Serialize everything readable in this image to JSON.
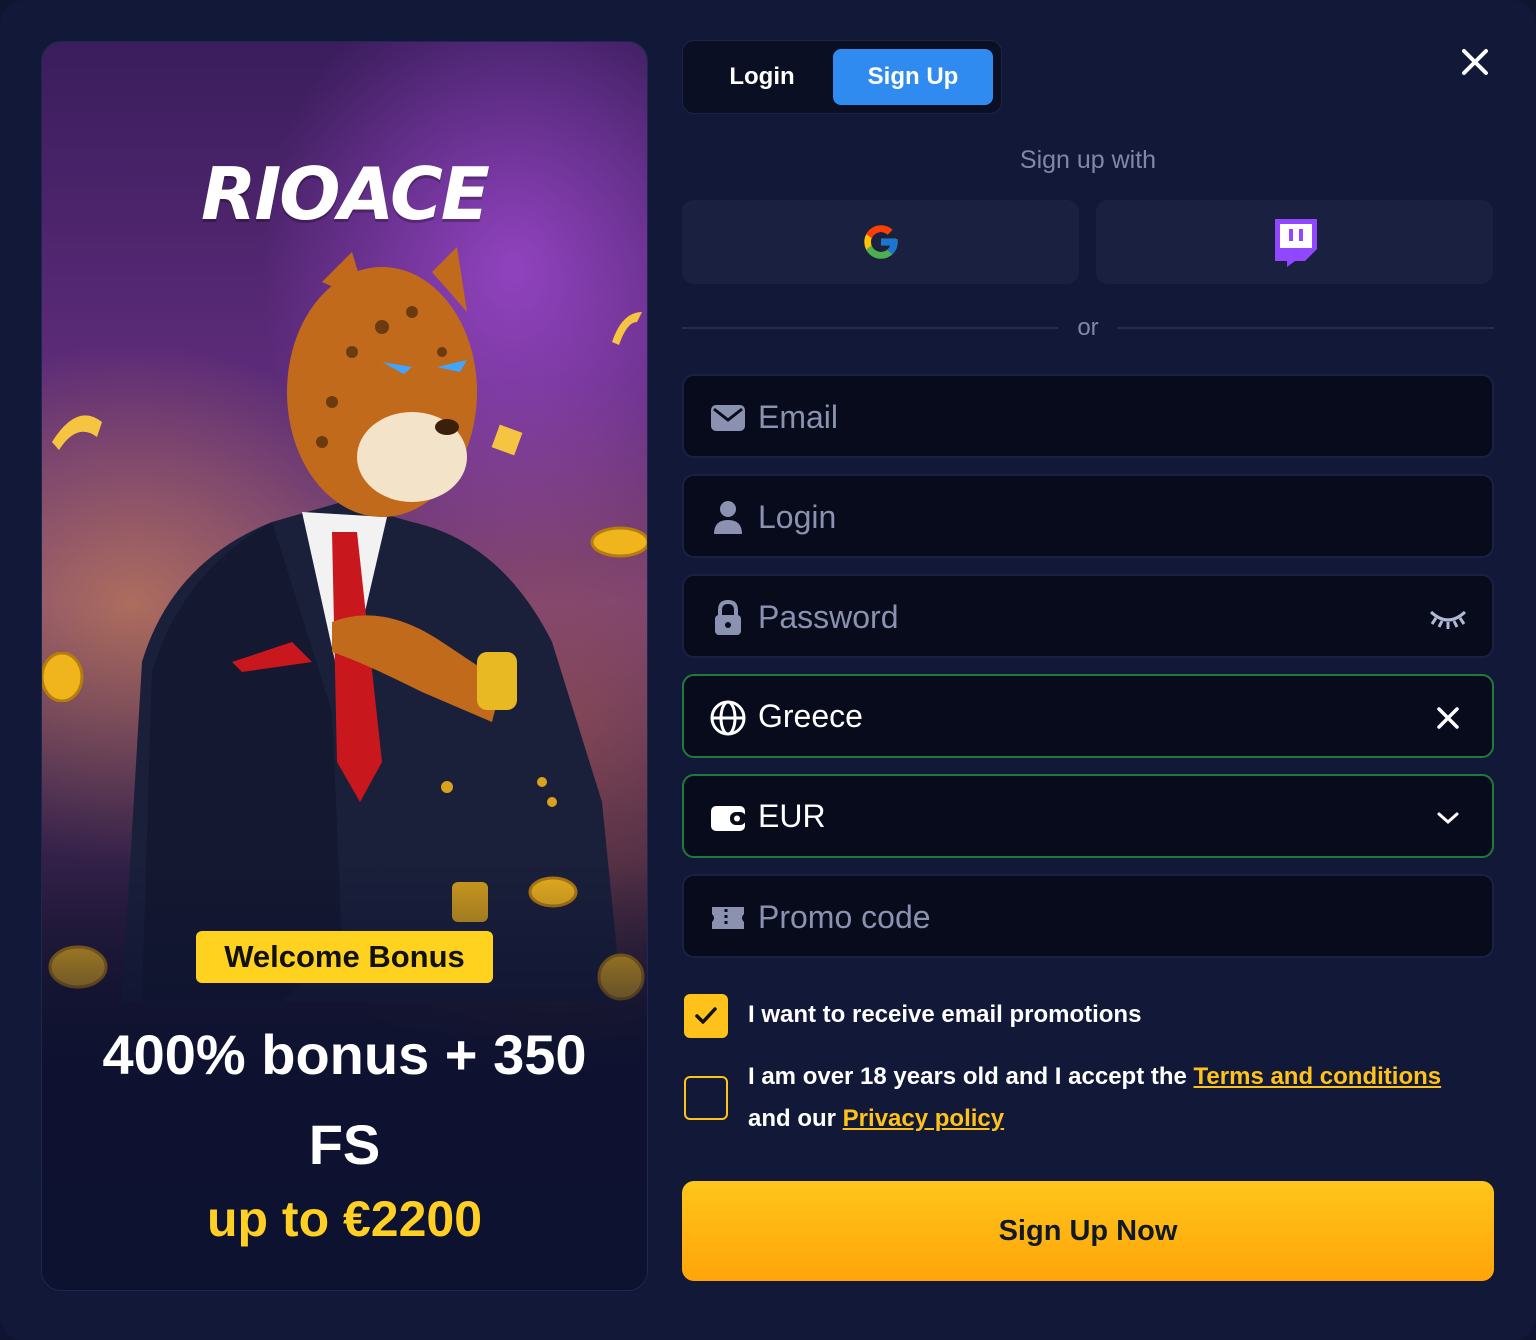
{
  "promo": {
    "logo_text": "RIOACE",
    "badge": "Welcome Bonus",
    "title": "400% bonus + 350 FS",
    "subtitle": "up to €2200"
  },
  "tabs": {
    "login_label": "Login",
    "signup_label": "Sign Up",
    "active": "Sign Up"
  },
  "social": {
    "heading": "Sign up with",
    "providers": [
      "google-icon",
      "twitch-icon"
    ],
    "divider": "or"
  },
  "form": {
    "email_placeholder": "Email",
    "login_placeholder": "Login",
    "password_placeholder": "Password",
    "country_value": "Greece",
    "currency_value": "EUR",
    "promo_placeholder": "Promo code"
  },
  "consents": {
    "email_promotions": {
      "label": "I want to receive email promotions",
      "checked": true
    },
    "age_terms": {
      "text_before": "I am over 18 years old and I accept the",
      "terms_link": "Terms and conditions",
      "text_middle": "and our",
      "privacy_link": "Privacy policy",
      "checked": false
    }
  },
  "submit_label": "Sign Up Now",
  "colors": {
    "background": "#111838",
    "tab_active": "#2f8bf0",
    "accent_yellow": "#ffc21a",
    "valid_border": "#1f7a3e",
    "twitch": "#9146ff"
  }
}
